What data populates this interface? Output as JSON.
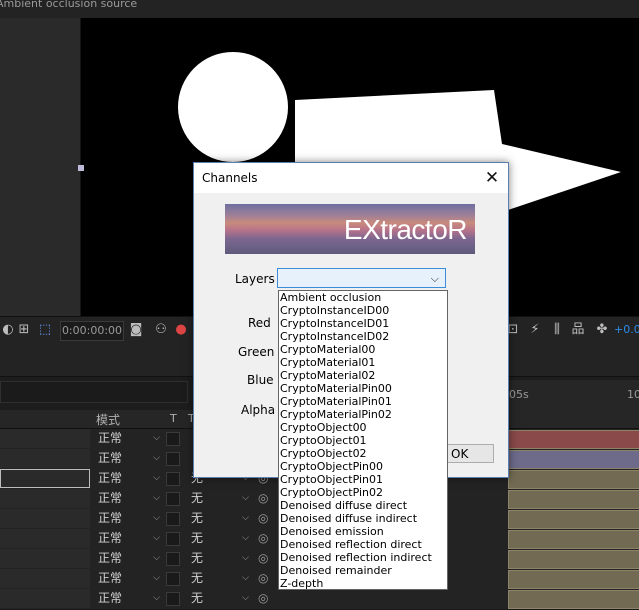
{
  "viewer": {
    "header_text": "Ambient occlusion source"
  },
  "toolbar": {
    "timecode": "0:00:00:00",
    "zoom_value": "+0.0"
  },
  "timeline": {
    "ruler": {
      "tick_05s": "05s",
      "tick_10": "10"
    },
    "columns": {
      "mode": "模式",
      "t": "T",
      "trkmat": "T"
    },
    "rows": [
      {
        "mode": "正常",
        "track": "",
        "bar_color": "#8a4a4a"
      },
      {
        "mode": "正常",
        "track": "",
        "bar_color": "#6d6a8a"
      },
      {
        "mode": "正常",
        "track": "无",
        "bar_color": "#726a53"
      },
      {
        "mode": "正常",
        "track": "无",
        "bar_color": "#726a53"
      },
      {
        "mode": "正常",
        "track": "无",
        "bar_color": "#726a53"
      },
      {
        "mode": "正常",
        "track": "无",
        "bar_color": "#726a53"
      },
      {
        "mode": "正常",
        "track": "无",
        "bar_color": "#726a53"
      },
      {
        "mode": "正常",
        "track": "无",
        "bar_color": "#726a53"
      },
      {
        "mode": "正常",
        "track": "无",
        "bar_color": "#726a53"
      }
    ]
  },
  "dialog": {
    "title": "Channels",
    "banner_text": "EXtractoR",
    "labels": {
      "layers": "Layers",
      "red": "Red",
      "green": "Green",
      "blue": "Blue",
      "alpha": "Alpha"
    },
    "layers_value": "",
    "ok_label": "OK"
  },
  "dropdown": {
    "options": [
      "Ambient occlusion",
      "CryptoInstanceID00",
      "CryptoInstanceID01",
      "CryptoInstanceID02",
      "CryptoMaterial00",
      "CryptoMaterial01",
      "CryptoMaterial02",
      "CryptoMaterialPin00",
      "CryptoMaterialPin01",
      "CryptoMaterialPin02",
      "CryptoObject00",
      "CryptoObject01",
      "CryptoObject02",
      "CryptoObjectPin00",
      "CryptoObjectPin01",
      "CryptoObjectPin02",
      "Denoised diffuse direct",
      "Denoised diffuse indirect",
      "Denoised emission",
      "Denoised reflection direct",
      "Denoised reflection indirect",
      "Denoised remainder",
      "Z-depth"
    ]
  },
  "colors": {
    "accent": "#2d8ceb",
    "dialog_border": "#5b7fb0",
    "selected_field": "#e7f1fb"
  }
}
